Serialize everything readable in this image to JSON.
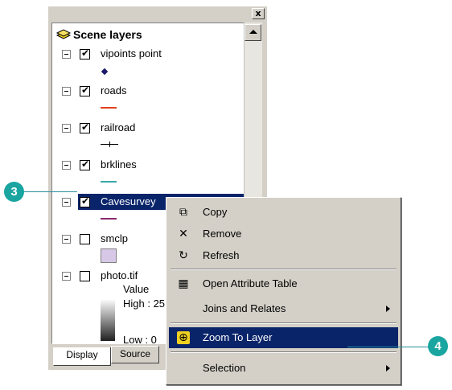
{
  "toc": {
    "close_glyph": "x",
    "header": "Scene layers",
    "layers": [
      {
        "label": "vipoints point",
        "checked": true,
        "symbol": "dot"
      },
      {
        "label": "roads",
        "checked": true,
        "symbol": "red-line"
      },
      {
        "label": "railroad",
        "checked": true,
        "symbol": "rail-line"
      },
      {
        "label": "brklines",
        "checked": true,
        "symbol": "teal-line"
      },
      {
        "label": "Cavesurvey",
        "checked": true,
        "symbol": "purple-line",
        "selected": true
      },
      {
        "label": "smclp",
        "checked": false,
        "symbol": "lavender-fill"
      },
      {
        "label": "photo.tif",
        "checked": false,
        "symbol": "raster"
      }
    ],
    "raster_legend": {
      "value_label": "Value",
      "high_label": "High : 25",
      "low_label": "Low : 0"
    },
    "tabs": {
      "display": "Display",
      "source": "Source"
    }
  },
  "menu": {
    "items": [
      {
        "label": "Copy",
        "icon": "copy-icon"
      },
      {
        "label": "Remove",
        "icon": "remove-icon"
      },
      {
        "label": "Refresh",
        "icon": "refresh-icon"
      },
      {
        "label": "Open Attribute Table",
        "icon": "table-icon"
      },
      {
        "label": "Joins and Relates",
        "submenu": true
      },
      {
        "label": "Zoom To Layer",
        "icon": "zoom-to-layer-icon",
        "highlighted": true
      },
      {
        "label": "Selection",
        "submenu": true
      }
    ]
  },
  "callouts": {
    "three": "3",
    "four": "4"
  },
  "colors": {
    "selection": "#0a246a",
    "callout": "#1aa5a0",
    "roads": "#e0401c",
    "brklines": "#3aa6a6",
    "cavesurvey": "#8a2a6a",
    "smclp": "#d8c8e8"
  }
}
